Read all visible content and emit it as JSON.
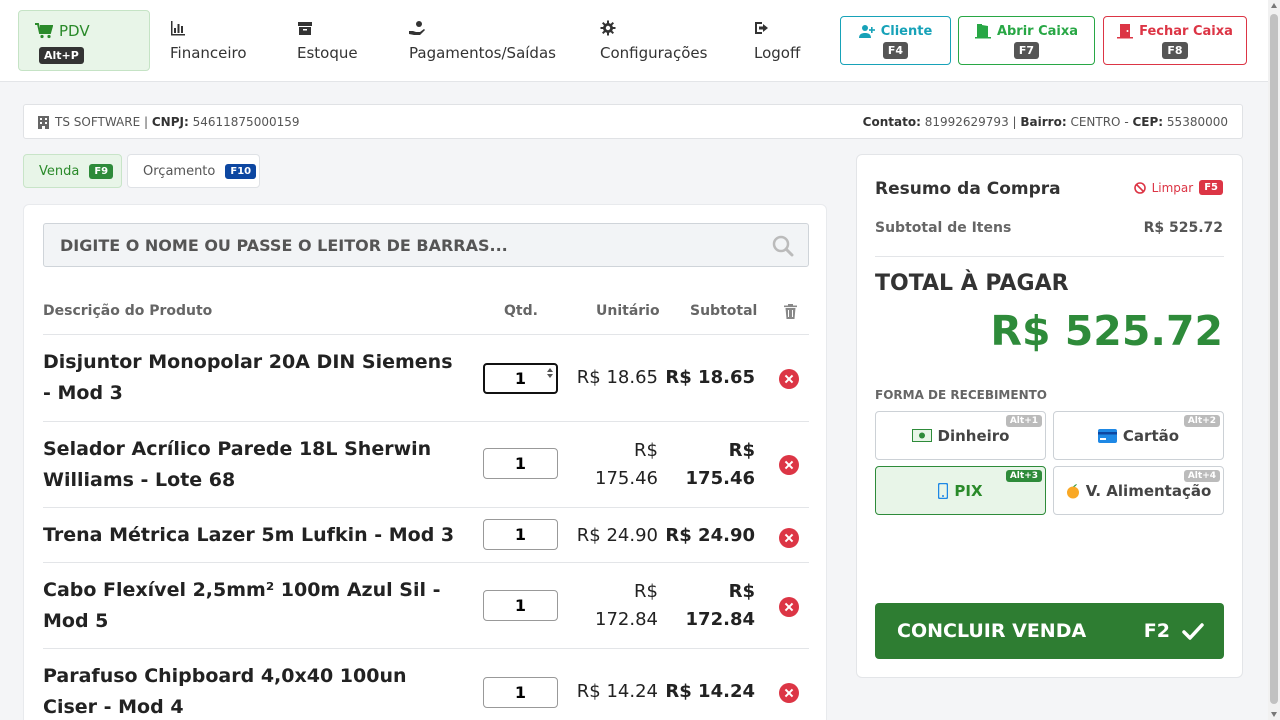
{
  "nav": {
    "pdv": {
      "label": "PDV",
      "shortcut": "Alt+P"
    },
    "items": [
      {
        "label": "Financeiro",
        "icon": "bar-chart-icon"
      },
      {
        "label": "Estoque",
        "icon": "box-icon"
      },
      {
        "label": "Pagamentos/Saídas",
        "icon": "hand-money-icon"
      },
      {
        "label": "Configurações",
        "icon": "gear-icon"
      },
      {
        "label": "Logoff",
        "icon": "logout-icon"
      }
    ],
    "actions": [
      {
        "label": "Cliente",
        "shortcut": "F4",
        "color": "#17a2b8"
      },
      {
        "label": "Abrir Caixa",
        "shortcut": "F7",
        "color": "#28a745"
      },
      {
        "label": "Fechar Caixa",
        "shortcut": "F8",
        "color": "#dc3545"
      }
    ]
  },
  "company": {
    "name": "TS SOFTWARE",
    "cnpj_label": "CNPJ:",
    "cnpj": "54611875000159",
    "contato_label": "Contato:",
    "contato": "81992629793",
    "bairro_label": "Bairro:",
    "bairro": "CENTRO",
    "cep_label": "CEP:",
    "cep": "55380000"
  },
  "tabs": [
    {
      "label": "Venda",
      "shortcut": "F9",
      "color": "#2e8b3a"
    },
    {
      "label": "Orçamento",
      "shortcut": "F10",
      "color": "#0d47a1"
    }
  ],
  "search": {
    "placeholder": "DIGITE O NOME OU PASSE O LEITOR DE BARRAS..."
  },
  "table": {
    "headers": {
      "desc": "Descrição do Produto",
      "qty": "Qtd.",
      "unit": "Unitário",
      "sub": "Subtotal"
    },
    "rows": [
      {
        "desc": "Disjuntor Monopolar 20A DIN Siemens - Mod 3",
        "qty": "1",
        "unit": "R$ 18.65",
        "sub": "R$ 18.65"
      },
      {
        "desc": "Selador Acrílico Parede 18L Sherwin Williams - Lote 68",
        "qty": "1",
        "unit": "R$ 175.46",
        "sub": "R$ 175.46"
      },
      {
        "desc": "Trena Métrica Lazer 5m Lufkin - Mod 3",
        "qty": "1",
        "unit": "R$ 24.90",
        "sub": "R$ 24.90"
      },
      {
        "desc": "Cabo Flexível 2,5mm² 100m Azul Sil - Mod 5",
        "qty": "1",
        "unit": "R$ 172.84",
        "sub": "R$ 172.84"
      },
      {
        "desc": "Parafuso Chipboard 4,0x40 100un Ciser - Mod 4",
        "qty": "1",
        "unit": "R$ 14.24",
        "sub": "R$ 14.24"
      }
    ]
  },
  "summary": {
    "title": "Resumo da Compra",
    "clear_label": "Limpar",
    "clear_shortcut": "F5",
    "subtotal_label": "Subtotal de Itens",
    "subtotal_value": "R$ 525.72",
    "total_label": "TOTAL À PAGAR",
    "total_value": "R$ 525.72",
    "payment_label": "FORMA DE RECEBIMENTO",
    "payments": [
      {
        "label": "Dinheiro",
        "shortcut": "Alt+1",
        "icon": "cash-icon"
      },
      {
        "label": "Cartão",
        "shortcut": "Alt+2",
        "icon": "credit-card-icon"
      },
      {
        "label": "PIX",
        "shortcut": "Alt+3",
        "icon": "mobile-icon",
        "selected": true
      },
      {
        "label": "V. Alimentação",
        "shortcut": "Alt+4",
        "icon": "apple-icon"
      }
    ],
    "confirm_label": "CONCLUIR VENDA",
    "confirm_shortcut": "F2"
  },
  "colors": {
    "primary_green": "#2e7d32",
    "accent_green": "#2e8b3a",
    "danger": "#dc3545"
  }
}
